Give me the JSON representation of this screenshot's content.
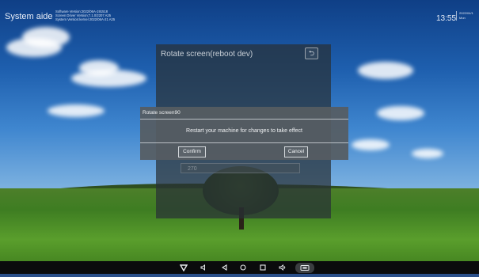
{
  "system": {
    "app_title": "System aide",
    "version_lines": [
      "Software Version:2022/06A-191518",
      "Screen Driver Version:7.1.0/2207 A25",
      "System Version:kernel 2022/06A-21 A25"
    ],
    "time": "13:55",
    "date_line1": "2022/04/1",
    "date_line2": "Mon"
  },
  "panel": {
    "title": "Rotate screen(reboot dev)",
    "back_icon": "return-icon",
    "option_value": "270"
  },
  "dialog": {
    "title": "Rotate screen90",
    "message": "Restart your machine for changes to take effect",
    "confirm_label": "Confirm",
    "cancel_label": "Cancel"
  },
  "navbar": {
    "icons": [
      "hide-nav-icon",
      "volume-down-icon",
      "back-icon",
      "home-icon",
      "recents-icon",
      "volume-up-icon",
      "screenshot-icon"
    ]
  }
}
